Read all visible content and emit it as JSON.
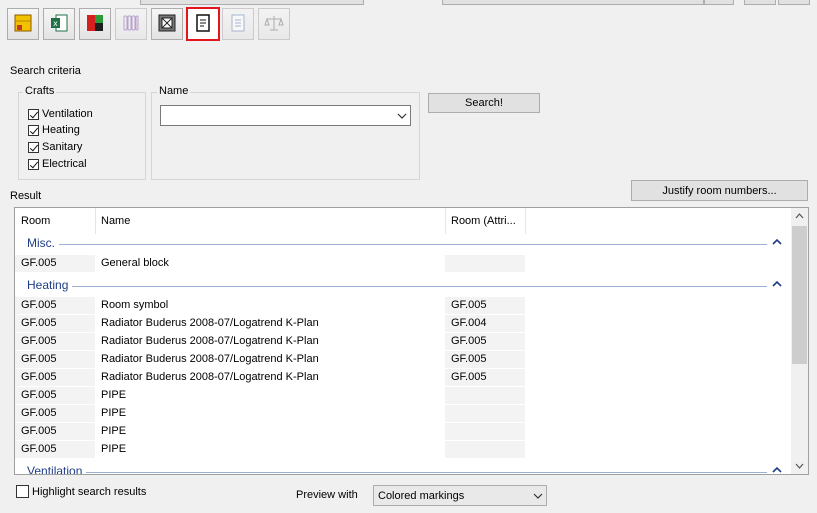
{
  "toolbar": {
    "buttons": [
      {
        "icon": "yellow-grid-icon"
      },
      {
        "icon": "excel-export-icon"
      },
      {
        "icon": "color-grid-icon"
      },
      {
        "icon": "radiator-icon"
      },
      {
        "icon": "frame-icon"
      },
      {
        "icon": "document-icon",
        "selected": true
      },
      {
        "icon": "report-icon"
      },
      {
        "icon": "balance-scale-icon"
      }
    ]
  },
  "search": {
    "title": "Search criteria",
    "crafts_title": "Crafts",
    "crafts": [
      {
        "label": "Ventilation",
        "checked": true
      },
      {
        "label": "Heating",
        "checked": true
      },
      {
        "label": "Sanitary",
        "checked": true
      },
      {
        "label": "Electrical",
        "checked": true
      }
    ],
    "name_title": "Name",
    "name_value": "",
    "search_button": "Search!"
  },
  "result": {
    "title": "Result",
    "justify_button": "Justify room numbers...",
    "columns": [
      "Room",
      "Name",
      "Room (Attri..."
    ],
    "groups": [
      {
        "name": "Misc.",
        "rows": [
          {
            "room": "GF.005",
            "name": "General block",
            "attr": ""
          }
        ]
      },
      {
        "name": "Heating",
        "rows": [
          {
            "room": "GF.005",
            "name": "Room symbol",
            "attr": "GF.005"
          },
          {
            "room": "GF.005",
            "name": "Radiator Buderus 2008-07/Logatrend K-Plan",
            "attr": "GF.004"
          },
          {
            "room": "GF.005",
            "name": "Radiator Buderus 2008-07/Logatrend K-Plan",
            "attr": "GF.005"
          },
          {
            "room": "GF.005",
            "name": "Radiator Buderus 2008-07/Logatrend K-Plan",
            "attr": "GF.005"
          },
          {
            "room": "GF.005",
            "name": "Radiator Buderus 2008-07/Logatrend K-Plan",
            "attr": "GF.005"
          },
          {
            "room": "GF.005",
            "name": "PIPE",
            "attr": ""
          },
          {
            "room": "GF.005",
            "name": "PIPE",
            "attr": ""
          },
          {
            "room": "GF.005",
            "name": "PIPE",
            "attr": ""
          },
          {
            "room": "GF.005",
            "name": "PIPE",
            "attr": ""
          }
        ]
      },
      {
        "name": "Ventilation",
        "rows": []
      }
    ]
  },
  "footer": {
    "highlight_label": "Highlight search results",
    "highlight_checked": false,
    "preview_label": "Preview with",
    "preview_value": "Colored markings"
  },
  "colors": {
    "accent": "#1f3c87",
    "selection_border": "#e0161c"
  }
}
